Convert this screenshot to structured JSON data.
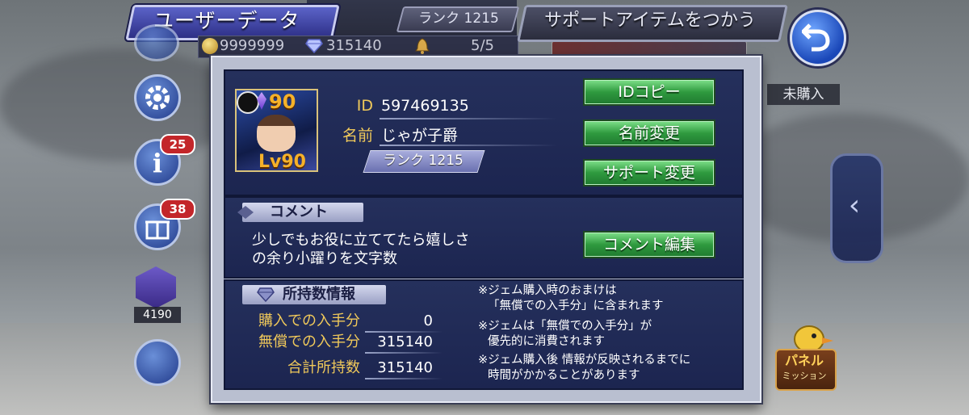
{
  "topbar": {
    "title": "ユーザーデータ",
    "rank": "ランク 1215",
    "gil": "9999999",
    "gems": "315140",
    "stamina": "5/5",
    "support_item_button": "サポートアイテムをつかう",
    "unpurchased_label": "未購入"
  },
  "side": {
    "info_badge": "25",
    "gift_badge": "38",
    "counter": "4190"
  },
  "panel_mission": {
    "line1": "パネル",
    "line2": "ミッション"
  },
  "profile": {
    "level_top": "90",
    "level_bottom": "Lv90",
    "id_label": "ID",
    "id_value": "597469135",
    "name_label": "名前",
    "name_value": "じゃが子爵",
    "rank_pill": "ランク 1215",
    "buttons": {
      "copy_id": "IDコピー",
      "change_name": "名前変更",
      "change_support": "サポート変更"
    }
  },
  "comment": {
    "title": "コメント",
    "line1": "少しでもお役に立ててたら嬉しさ",
    "line2": "の余り小躍りを文字数",
    "edit_button": "コメント編集"
  },
  "holdings": {
    "title": "所持数情報",
    "rows": [
      {
        "label": "購入での入手分",
        "value": "0"
      },
      {
        "label": "無償での入手分",
        "value": "315140"
      },
      {
        "label": "合計所持数",
        "value": "315140"
      }
    ],
    "notes": [
      {
        "line1": "※ジェム購入時のおまけは",
        "line2": "「無償での入手分」に含まれます"
      },
      {
        "line1": "※ジェムは「無償での入手分」が",
        "line2": "優先的に消費されます"
      },
      {
        "line1": "※ジェム購入後 情報が反映されるまでに",
        "line2": "時間がかかることがあります"
      }
    ]
  }
}
